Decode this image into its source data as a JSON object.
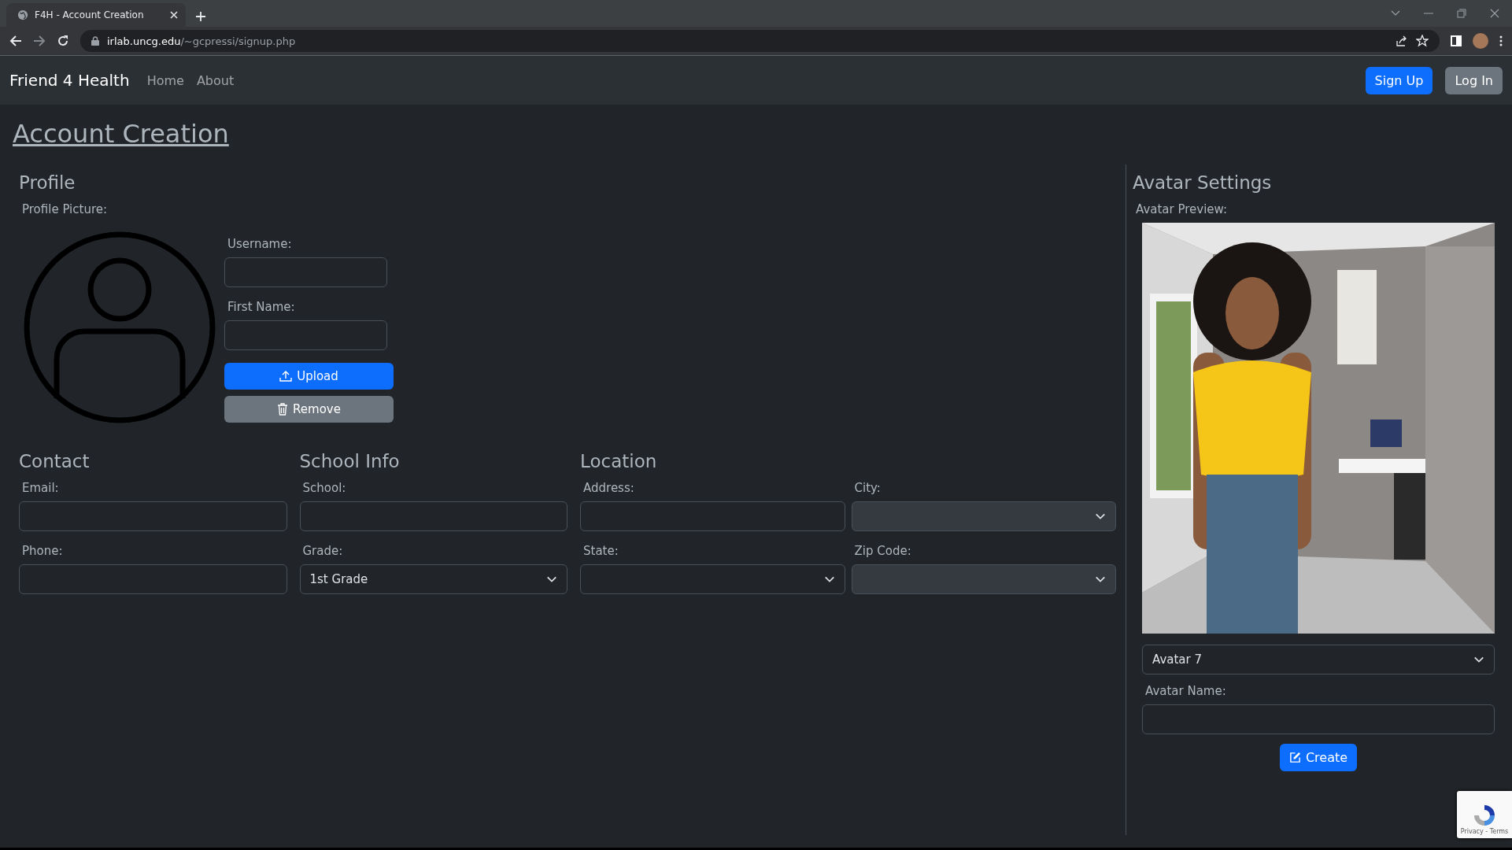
{
  "browser": {
    "tab_title": "F4H - Account Creation",
    "url_host": "irlab.uncg.edu",
    "url_path": "/~gcpressi/signup.php"
  },
  "navbar": {
    "brand": "Friend 4 Health",
    "links": [
      "Home",
      "About"
    ],
    "buttons": [
      {
        "label": "Sign Up",
        "kind": "primary"
      },
      {
        "label": "Log In",
        "kind": "secondary"
      }
    ]
  },
  "page_title": "Account Creation",
  "profile": {
    "heading": "Profile",
    "picture_label": "Profile Picture:",
    "fields": [
      {
        "label": "Username:"
      },
      {
        "label": "First Name:"
      }
    ],
    "buttons": [
      {
        "label": "Upload",
        "kind": "upload"
      },
      {
        "label": "Remove",
        "kind": "remove"
      }
    ]
  },
  "sections": [
    {
      "heading": "Contact",
      "fields": [
        {
          "label": "Email:",
          "kind": "text",
          "disabled": false
        },
        {
          "label": "Phone:",
          "kind": "text",
          "disabled": false
        }
      ]
    },
    {
      "heading": "School Info",
      "fields": [
        {
          "label": "School:",
          "kind": "text",
          "disabled": false
        },
        {
          "label": "Grade:",
          "kind": "select",
          "value": "1st Grade",
          "disabled": false
        }
      ]
    },
    {
      "heading": "Location",
      "fields": [
        {
          "label": "Address:",
          "kind": "text",
          "disabled": false
        },
        {
          "label": "City:",
          "kind": "select",
          "disabled": true
        },
        {
          "label": "State:",
          "kind": "select",
          "disabled": false
        },
        {
          "label": "Zip Code:",
          "kind": "select",
          "disabled": true
        }
      ]
    }
  ],
  "avatar": {
    "heading": "Avatar Settings",
    "preview_label": "Avatar Preview:",
    "select_value": "Avatar 7",
    "name_label": "Avatar Name:",
    "button": "Create"
  },
  "recaptcha": {
    "text": "Privacy - Terms"
  }
}
